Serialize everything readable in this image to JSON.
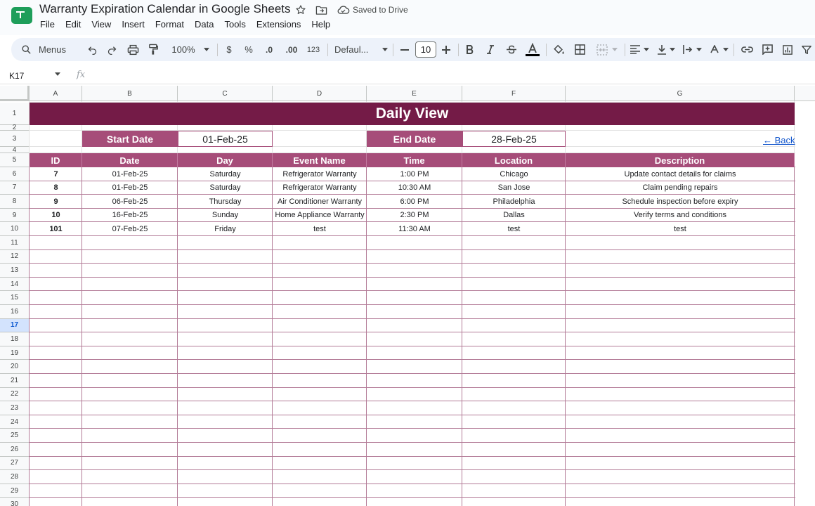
{
  "app": {
    "doc_title": "Warranty Expiration Calendar in Google Sheets",
    "saved_status": "Saved to Drive",
    "menus": [
      "File",
      "Edit",
      "View",
      "Insert",
      "Format",
      "Data",
      "Tools",
      "Extensions",
      "Help"
    ]
  },
  "toolbar": {
    "search_label": "Menus",
    "zoom": "100%",
    "currency": "$",
    "percent": "%",
    "decrease_decimal": ".0",
    "increase_decimal": ".00",
    "number_format": "123",
    "font": "Defaul...",
    "font_size": "10"
  },
  "formula_bar": {
    "cell_ref": "K17",
    "fx_label": "fx"
  },
  "grid": {
    "columns": [
      "A",
      "B",
      "C",
      "D",
      "E",
      "F",
      "G"
    ],
    "rows": [
      "1",
      "2",
      "3",
      "4",
      "5",
      "6",
      "7",
      "8",
      "9",
      "10",
      "11",
      "12",
      "13",
      "14",
      "15",
      "16",
      "17",
      "18",
      "19",
      "20",
      "21",
      "22",
      "23",
      "24",
      "25",
      "26",
      "27",
      "28",
      "29",
      "30"
    ],
    "active_row": "17"
  },
  "sheet": {
    "title": "Daily View",
    "start_date_label": "Start Date",
    "start_date": "01-Feb-25",
    "end_date_label": "End Date",
    "end_date": "28-Feb-25",
    "back_link": "← Back",
    "table": {
      "headers": [
        "ID",
        "Date",
        "Day",
        "Event Name",
        "Time",
        "Location",
        "Description"
      ],
      "rows": [
        [
          "7",
          "01-Feb-25",
          "Saturday",
          "Refrigerator Warranty",
          "1:00 PM",
          "Chicago",
          "Update contact details for claims"
        ],
        [
          "8",
          "01-Feb-25",
          "Saturday",
          "Refrigerator Warranty",
          "10:30 AM",
          "San Jose",
          "Claim pending repairs"
        ],
        [
          "9",
          "06-Feb-25",
          "Thursday",
          "Air Conditioner Warranty",
          "6:00 PM",
          "Philadelphia",
          "Schedule inspection before expiry"
        ],
        [
          "10",
          "16-Feb-25",
          "Sunday",
          "Home Appliance Warranty",
          "2:30 PM",
          "Dallas",
          "Verify terms and conditions"
        ],
        [
          "101",
          "07-Feb-25",
          "Friday",
          "test",
          "11:30 AM",
          "test",
          "test"
        ]
      ]
    }
  },
  "colors": {
    "banner": "#741b47",
    "header": "#a64d79",
    "link": "#1155cc"
  }
}
